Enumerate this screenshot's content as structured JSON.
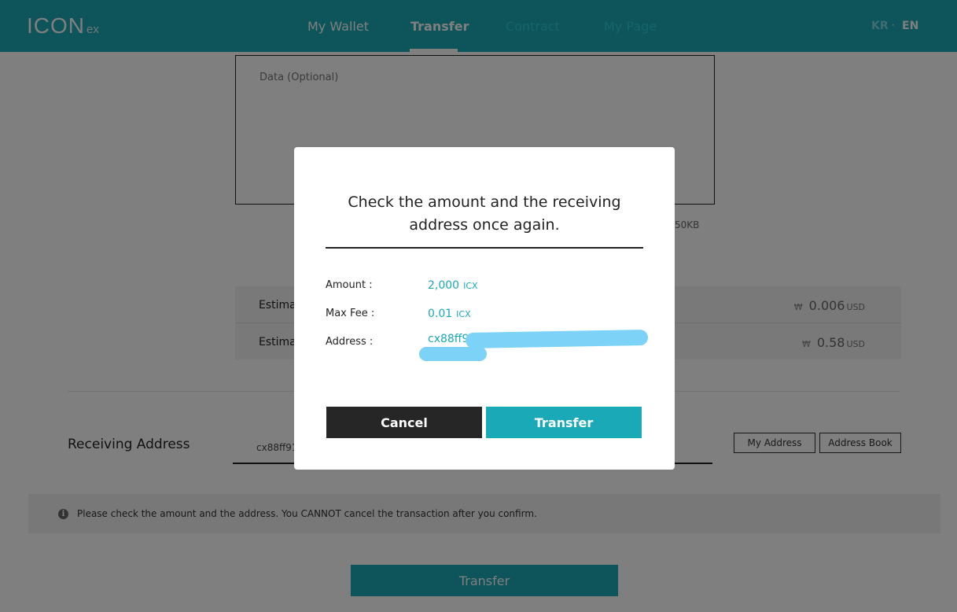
{
  "header": {
    "logo_text": "ICON",
    "logo_sub": "ex",
    "nav": [
      {
        "label": "My Wallet"
      },
      {
        "label": "Transfer"
      },
      {
        "label": "Contract"
      },
      {
        "label": "My Page"
      }
    ],
    "lang_kr": "KR",
    "lang_sep": "·",
    "lang_en": "EN"
  },
  "form": {
    "data_placeholder": "Data (Optional)",
    "data_limit_note": "50KB",
    "estimate_rows": [
      {
        "label": "Estima",
        "value": "0.006",
        "unit": "USD",
        "currency_symbol": "₩"
      },
      {
        "label": "Estima",
        "value": "0.58",
        "unit": "USD",
        "currency_symbol": "₩"
      }
    ],
    "receiving_label": "Receiving Address",
    "receiving_value": "cx88ff91",
    "my_address_label": "My Address",
    "address_book_label": "Address Book",
    "notice_icon": "i",
    "notice": "Please check the amount and the address. You CANNOT cancel the transaction after you confirm.",
    "transfer_label": "Transfer"
  },
  "modal": {
    "title_line1": "Check the amount and the receiving",
    "title_line2": "address once again.",
    "amount_label": "Amount :",
    "amount_value": "2,000",
    "amount_unit": "ICX",
    "fee_label": "Max Fee :",
    "fee_value": "0.01",
    "fee_unit": "ICX",
    "address_label": "Address :",
    "address_value": "cx88ff9",
    "cancel_label": "Cancel",
    "transfer_label": "Transfer"
  },
  "colors": {
    "brand": "#1aa9b6",
    "redaction": "#7dd3f7",
    "cancel": "#262626"
  }
}
